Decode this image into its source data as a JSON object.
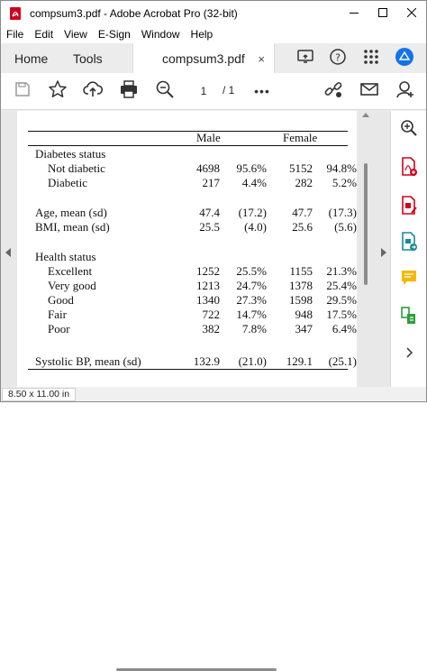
{
  "window": {
    "title": "compsum3.pdf - Adobe Acrobat Pro (32-bit)",
    "minimize_icon": "minimize-icon",
    "maximize_icon": "maximize-icon",
    "close_icon": "close-icon"
  },
  "menu": [
    "File",
    "Edit",
    "View",
    "E-Sign",
    "Window",
    "Help"
  ],
  "tabs": {
    "home": "Home",
    "tools": "Tools",
    "document": "compsum3.pdf",
    "close": "×"
  },
  "toolbar": {
    "page_current": "1",
    "page_total": "/  1",
    "more": "•••"
  },
  "table": {
    "header": {
      "male": "Male",
      "female": "Female"
    },
    "rows": [
      {
        "label": "Diabetes status",
        "indent": false,
        "v": [
          "",
          "",
          "",
          ""
        ]
      },
      {
        "label": "Not diabetic",
        "indent": true,
        "v": [
          "4698",
          "95.6%",
          "5152",
          "94.8%"
        ]
      },
      {
        "label": "Diabetic",
        "indent": true,
        "v": [
          "217",
          "4.4%",
          "282",
          "5.2%"
        ]
      },
      {
        "label": "Age, mean (sd)",
        "indent": false,
        "v": [
          "47.4",
          "(17.2)",
          "47.7",
          "(17.3)"
        ]
      },
      {
        "label": "BMI, mean (sd)",
        "indent": false,
        "v": [
          "25.5",
          "(4.0)",
          "25.6",
          "(5.6)"
        ]
      },
      {
        "label": "Health status",
        "indent": false,
        "v": [
          "",
          "",
          "",
          ""
        ]
      },
      {
        "label": "Excellent",
        "indent": true,
        "v": [
          "1252",
          "25.5%",
          "1155",
          "21.3%"
        ]
      },
      {
        "label": "Very good",
        "indent": true,
        "v": [
          "1213",
          "24.7%",
          "1378",
          "25.4%"
        ]
      },
      {
        "label": "Good",
        "indent": true,
        "v": [
          "1340",
          "27.3%",
          "1598",
          "29.5%"
        ]
      },
      {
        "label": "Fair",
        "indent": true,
        "v": [
          "722",
          "14.7%",
          "948",
          "17.5%"
        ]
      },
      {
        "label": "Poor",
        "indent": true,
        "v": [
          "382",
          "7.8%",
          "347",
          "6.4%"
        ]
      },
      {
        "label": "Systolic BP, mean (sd)",
        "indent": false,
        "v": [
          "132.9",
          "(21.0)",
          "129.1",
          "(25.1)"
        ]
      }
    ]
  },
  "status": {
    "page_size": "8.50 x 11.00 in"
  },
  "colors": {
    "acrobat_red": "#d0021b",
    "accent_blue": "#1473e6",
    "comment_yellow": "#f5b800",
    "green": "#2d9d3a"
  }
}
